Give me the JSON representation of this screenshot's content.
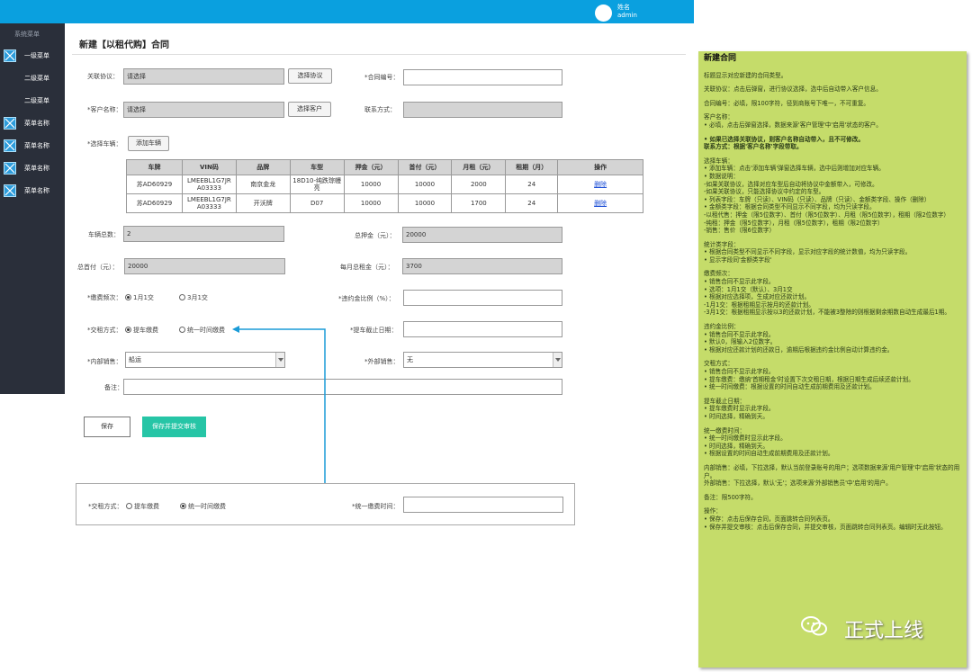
{
  "header": {
    "user_name": "姓名",
    "user_role": "admin"
  },
  "sidebar": {
    "title": "系统菜单",
    "items": [
      {
        "label": "一级菜单",
        "icon": "square-x-icon",
        "has_icon": true
      },
      {
        "label": "二级菜单",
        "has_icon": false
      },
      {
        "label": "二级菜单",
        "has_icon": false
      },
      {
        "label": "菜单名称",
        "icon": "square-x-icon",
        "has_icon": true
      },
      {
        "label": "菜单名称",
        "icon": "square-x-icon",
        "has_icon": true
      },
      {
        "label": "菜单名称",
        "icon": "square-x-icon",
        "has_icon": true
      },
      {
        "label": "菜单名称",
        "icon": "square-x-icon",
        "has_icon": true
      }
    ]
  },
  "page": {
    "title": "新建【以租代购】合同"
  },
  "form": {
    "agreement": {
      "label": "关联协议：",
      "value": "请选择",
      "button": "选择协议"
    },
    "contract_no": {
      "label": "*合同编号：",
      "value": ""
    },
    "customer": {
      "label": "*客户名称：",
      "value": "请选择",
      "button": "选择客户"
    },
    "contact": {
      "label": "联系方式：",
      "value": ""
    },
    "vehicle": {
      "label": "*选择车辆：",
      "button": "添加车辆"
    },
    "table": {
      "headers": [
        "车牌",
        "VIN码",
        "品牌",
        "车型",
        "押金（元）",
        "首付（元）",
        "月租（元）",
        "租期（月）",
        "操作"
      ],
      "rows": [
        [
          "苏AD60929",
          "LMEEBL1G7JR A03333",
          "南京金龙",
          "18D10-纯跌琮幔 亮",
          "10000",
          "10000",
          "2000",
          "24",
          "删除"
        ],
        [
          "苏AD60929",
          "LMEEBL1G7JR A03333",
          "开沃牌",
          "D07",
          "10000",
          "10000",
          "1700",
          "24",
          "删除"
        ]
      ]
    },
    "vehicle_total": {
      "label": "车辆总数：",
      "value": "2"
    },
    "total_deposit": {
      "label": "总押金（元）：",
      "value": "20000"
    },
    "total_down": {
      "label": "总首付（元）：",
      "value": "20000"
    },
    "monthly_rent": {
      "label": "每月总租金（元）：",
      "value": "3700"
    },
    "payment_freq": {
      "label": "*缴费频次：",
      "opt1": "1月1交",
      "opt2": "3月1交"
    },
    "penalty": {
      "label": "*违约金比例（%）：",
      "value": ""
    },
    "rent_mode": {
      "label": "*交租方式：",
      "opt1": "提车缴费",
      "opt2": "统一时间缴费"
    },
    "pickup_date": {
      "label": "*提车截止日期：",
      "value": ""
    },
    "internal_sales": {
      "label": "*内部销售：",
      "value": "船运"
    },
    "external_sales": {
      "label": "*外部销售：",
      "value": "无"
    },
    "remark": {
      "label": "备注：",
      "value": ""
    }
  },
  "actions": {
    "save": "保存",
    "submit": "保存并提交审核"
  },
  "alt_form": {
    "rent_mode_label": "*交租方式：",
    "opt1": "提车缴费",
    "opt2": "统一时间缴费",
    "unified_time_label": "*统一缴费时间："
  },
  "note": {
    "title": "新建合同",
    "paragraphs": [
      {
        "text": "标题显示对应新建的合同类型。",
        "bold": false
      },
      {
        "text": "关联协议：点击后弹窗，进行协议选择，选中后自动带入客户信息。",
        "bold": false
      },
      {
        "text": "合同编号：必填，限100字符，径到商账号下唯一，不可重复。",
        "bold": false
      },
      {
        "text": "客户名称：\n• 必填，点击后弹窗选择，数据来源'客户管理'中'启用'状态的客户。",
        "bold": false
      },
      {
        "text": "• 如果已选择关联协议，则客户名称自动带入，且不可修改。\n联系方式：根据'客户名称'字段带取。",
        "bold": true
      },
      {
        "text": "选择车辆：\n• 添加车辆：点击'添加车辆'弹窗选择车辆，选中后则增加对应车辆。\n• 数据说明：\n-如果关联协议，选择对应车型后自动将协议中金额带入，可修改。\n-如果关联协议，只能选择协议中约定的车型。\n• 列表字段：车牌（只读）、VIN码（只读）、品牌（只读）、金额类字段、操作（删除）\n• 金额类字段：根据合同类型不同显示不同字段，均为只读字段。\n-以租代售：押金（限5位数字）、首付（限5位数字）、月租（限5位数字），租期（限2位数字）\n-纯租：押金（限5位数字），月租（限5位数字），租期（限2位数字）\n-销售：售价（限6位数字）",
        "bold": false
      },
      {
        "text": "统计类字段：\n• 根据合同类型不同显示不同字段，显示对应字段的统计数值，均为只读字段。\n• 显示字段同'金额类字段'",
        "bold": false
      },
      {
        "text": "缴费频次：\n• 销售合同不显示此字段。\n• 选项：1月1交（默认）、3月1交\n• 根据对应选择项，生成对应还款计划。\n-1月1交：根据租期显示按月的还款计划。\n-3月1交：根据租期显示按以3的还款计划，不能被3整除的则根据剩余期数自动生成最后1期。",
        "bold": false
      },
      {
        "text": "违约金比例：\n• 销售合同不显示此字段。\n• 默认0，限输入2位数字。\n• 根据对应还款计划的还款日，逾期后根据违约金比例自动计算违约金。",
        "bold": false
      },
      {
        "text": "交租方式：\n• 销售合同不显示此字段。\n• 提车缴费：缴纳'首期租金'时设置下次交租日期，根据日期生成后续还款计划。\n• 统一时间缴费：根据设置的时间自动生成前期费用及还款计划。",
        "bold": false
      },
      {
        "text": "提车截止日期：\n• 提车缴费时显示此字段。\n• 时间选择，精确到天。",
        "bold": false
      },
      {
        "text": "统一缴费时间：\n• 统一时间缴费时显示此字段。\n• 时间选择，精确到天。\n• 根据设置的时间自动生成前期费用及还款计划。",
        "bold": false
      },
      {
        "text": "内部销售：必填，下拉选择，默认当前登录账号的用户；选项数据来源'用户管理'中'启用'状态的用户。\n外部销售：下拉选择，默认'无'；选项来源'外部销售员'中'启用'的用户。",
        "bold": false
      },
      {
        "text": "备注：限500字符。",
        "bold": false
      },
      {
        "text": "操作：\n• 保存：点击后保存合同，页面跳转合同列表页。\n• 保存并提交审核：点击后保存合同，并提交审核，页面跳转合同列表页。编辑时无此按钮。",
        "bold": false
      }
    ]
  },
  "watermark": {
    "text": "正式上线",
    "icon": "wechat-icon"
  }
}
